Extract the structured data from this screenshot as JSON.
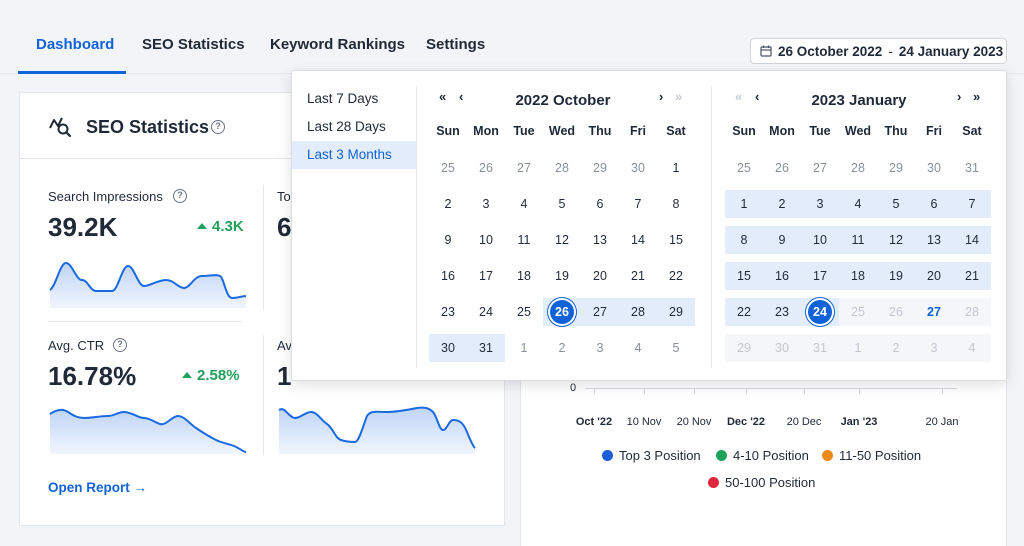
{
  "nav": {
    "tabs": [
      {
        "label": "Dashboard",
        "active": true
      },
      {
        "label": "SEO Statistics",
        "active": false
      },
      {
        "label": "Keyword Rankings",
        "active": false
      },
      {
        "label": "Settings",
        "active": false
      }
    ],
    "date_range": {
      "start": "26 October 2022",
      "separator": "-",
      "end": "24 January 2023",
      "icon": "calendar-icon"
    }
  },
  "seo_card": {
    "title": "SEO Statistics",
    "help": "?",
    "metrics": [
      {
        "label": "Search Impressions",
        "value": "39.2K",
        "delta": "4.3K",
        "trend": "up"
      },
      {
        "label": "Total Clicks",
        "label_visible": "To",
        "value": "6",
        "delta": "",
        "trend": "up"
      },
      {
        "label": "Avg. CTR",
        "value": "16.78%",
        "delta": "2.58%",
        "trend": "up"
      },
      {
        "label": "Avg. Position",
        "label_visible": "Av",
        "value": "1",
        "delta": "",
        "trend": "up"
      }
    ],
    "open_report": "Open Report →",
    "accent": "#1062d8",
    "positive_color": "#22a05b"
  },
  "position_chart": {
    "y_zero": "0",
    "x_ticks": [
      {
        "label": "Oct '22",
        "bold": true
      },
      {
        "label": "10 Nov",
        "bold": false
      },
      {
        "label": "20 Nov",
        "bold": false
      },
      {
        "label": "Dec '22",
        "bold": true
      },
      {
        "label": "20 Dec",
        "bold": false
      },
      {
        "label": "Jan '23",
        "bold": true
      },
      {
        "label": "20 Jan",
        "bold": false
      }
    ],
    "legend": [
      {
        "label": "Top 3 Position",
        "color": "#1a5fd9"
      },
      {
        "label": "4-10 Position",
        "color": "#1fa35a"
      },
      {
        "label": "11-50 Position",
        "color": "#f08a1c"
      },
      {
        "label": "50-100 Position",
        "color": "#e0283c"
      }
    ]
  },
  "date_picker": {
    "presets": [
      {
        "label": "Last 7 Days",
        "active": false
      },
      {
        "label": "Last 28 Days",
        "active": false
      },
      {
        "label": "Last 3 Months",
        "active": true
      }
    ],
    "weekdays": [
      "Sun",
      "Mon",
      "Tue",
      "Wed",
      "Thu",
      "Fri",
      "Sat"
    ],
    "months": [
      {
        "title": "2022 October",
        "prev_year": "«",
        "prev_month": "‹",
        "next_month": "›",
        "next_year": "»",
        "days": [
          [
            "25",
            "26",
            "27",
            "28",
            "29",
            "30",
            "1"
          ],
          [
            "2",
            "3",
            "4",
            "5",
            "6",
            "7",
            "8"
          ],
          [
            "9",
            "10",
            "11",
            "12",
            "13",
            "14",
            "15"
          ],
          [
            "16",
            "17",
            "18",
            "19",
            "20",
            "21",
            "22"
          ],
          [
            "23",
            "24",
            "25",
            "26",
            "27",
            "28",
            "29"
          ],
          [
            "30",
            "31",
            "1",
            "2",
            "3",
            "4",
            "5"
          ]
        ],
        "selected_start": "26"
      },
      {
        "title": "2023 January",
        "prev_year": "«",
        "prev_month": "‹",
        "next_month": "›",
        "next_year": "»",
        "days": [
          [
            "25",
            "26",
            "27",
            "28",
            "29",
            "30",
            "31"
          ],
          [
            "1",
            "2",
            "3",
            "4",
            "5",
            "6",
            "7"
          ],
          [
            "8",
            "9",
            "10",
            "11",
            "12",
            "13",
            "14"
          ],
          [
            "15",
            "16",
            "17",
            "18",
            "19",
            "20",
            "21"
          ],
          [
            "22",
            "23",
            "24",
            "25",
            "26",
            "27",
            "28"
          ],
          [
            "29",
            "30",
            "31",
            "1",
            "2",
            "3",
            "4"
          ]
        ],
        "selected_end": "24",
        "today": "27"
      }
    ]
  }
}
